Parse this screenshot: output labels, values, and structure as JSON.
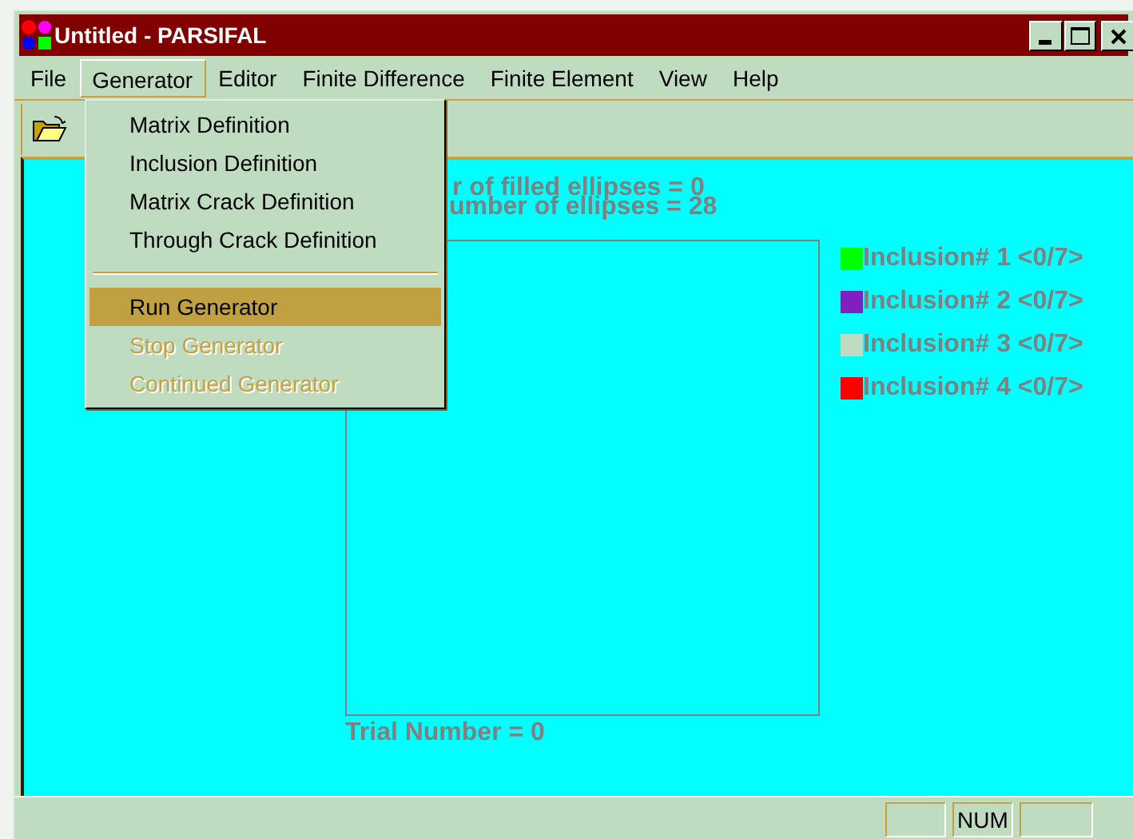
{
  "window": {
    "title": "Untitled - PARSIFAL"
  },
  "menu_bar": [
    {
      "label": "File",
      "selected": false
    },
    {
      "label": "Generator",
      "selected": true
    },
    {
      "label": "Editor",
      "selected": false
    },
    {
      "label": "Finite Difference",
      "selected": false
    },
    {
      "label": "Finite Element",
      "selected": false
    },
    {
      "label": "View",
      "selected": false
    },
    {
      "label": "Help",
      "selected": false
    }
  ],
  "generator_menu": [
    {
      "kind": "item",
      "label": "Matrix Definition",
      "selected": false,
      "disabled": false
    },
    {
      "kind": "item",
      "label": "Inclusion Definition",
      "selected": false,
      "disabled": false
    },
    {
      "kind": "item",
      "label": "Matrix Crack Definition",
      "selected": false,
      "disabled": false
    },
    {
      "kind": "item",
      "label": "Through Crack Definition",
      "selected": false,
      "disabled": false
    },
    {
      "kind": "separator"
    },
    {
      "kind": "item",
      "label": "Run Generator",
      "selected": true,
      "disabled": false
    },
    {
      "kind": "item",
      "label": "Stop Generator",
      "selected": false,
      "disabled": true
    },
    {
      "kind": "item",
      "label": "Continued Generator",
      "selected": false,
      "disabled": true
    }
  ],
  "canvas": {
    "stats": [
      "r of filled ellipses = 0",
      "umber of ellipses = 28"
    ],
    "legend": [
      {
        "label": "Inclusion# 1 <0/7>",
        "color": "#00ff00"
      },
      {
        "label": "Inclusion# 2 <0/7>",
        "color": "#8020c0"
      },
      {
        "label": "Inclusion# 3 <0/7>",
        "color": "#c0dcc0"
      },
      {
        "label": "Inclusion# 4 <0/7>",
        "color": "#ff0000"
      }
    ],
    "trial": "Trial Number = 0"
  },
  "status_bar": {
    "panes": [
      {
        "text": "NUM"
      }
    ]
  }
}
